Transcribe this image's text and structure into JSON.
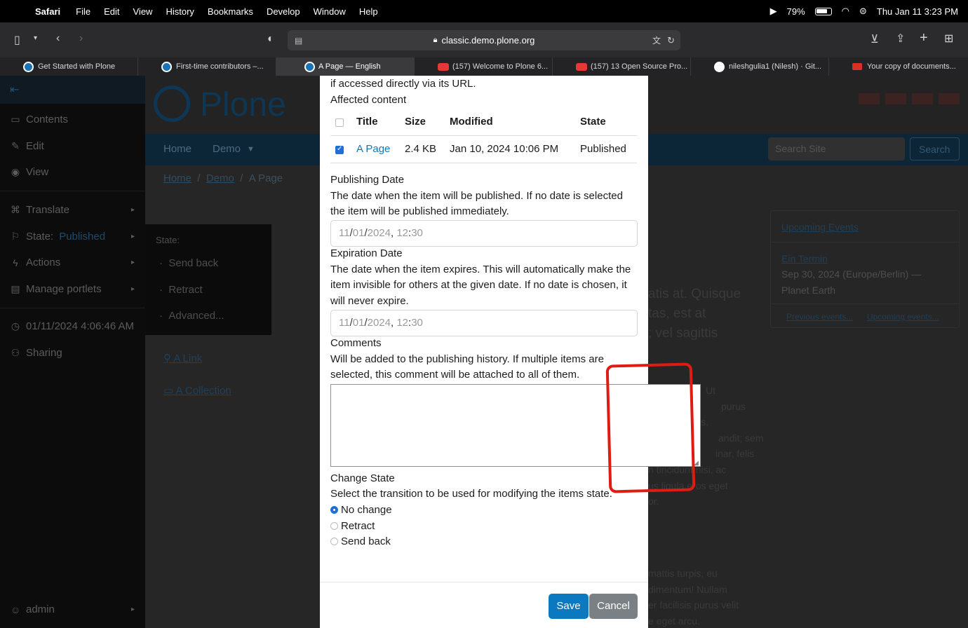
{
  "menubar": {
    "app": "Safari",
    "items": [
      "File",
      "Edit",
      "View",
      "History",
      "Bookmarks",
      "Develop",
      "Window",
      "Help"
    ],
    "battery": "79%",
    "datetime": "Thu Jan 11  3:23 PM"
  },
  "browser": {
    "url": "classic.demo.plone.org",
    "tabs": [
      {
        "title": "Get Started with Plone"
      },
      {
        "title": "First-time contributors –..."
      },
      {
        "title": "A Page — English"
      },
      {
        "title": "(157) Welcome to Plone 6..."
      },
      {
        "title": "(157) 13 Open Source Pro..."
      },
      {
        "title": "nileshgulia1 (Nilesh) · Git..."
      },
      {
        "title": "Your copy of documents..."
      }
    ]
  },
  "sidebar": {
    "items": [
      "Contents",
      "Edit",
      "View",
      "Translate",
      "State:",
      "Actions",
      "Manage portlets"
    ],
    "state_value": "Published",
    "date": "01/11/2024 4:06:46 AM",
    "sharing": "Sharing",
    "user": "admin"
  },
  "site": {
    "logo": "Plone",
    "nav": [
      "Home",
      "Demo"
    ],
    "search_placeholder": "Search Site",
    "search_button": "Search",
    "breadcrumb": [
      "Home",
      "Demo",
      "A Page"
    ],
    "state_menu": {
      "label": "State:",
      "items": [
        "Send back",
        "Retract",
        "Advanced..."
      ]
    },
    "links": [
      "A Link",
      "A Collection"
    ],
    "portlet": {
      "title": "Upcoming Events",
      "event_title": "Ein Termin",
      "event_date": "Sep 30, 2024 (Europe/Berlin) —",
      "event_location": "Planet Earth",
      "prev": "Previous events...",
      "next": "Upcoming events..."
    },
    "bg_text": [
      "atis at. Quisque",
      "tas, est at",
      "; vel sagittis",
      "Ut",
      "purus",
      "is.",
      "andit; sem",
      "inar, felis",
      "n tincidunt nisi, ac",
      "us ligula eros eget",
      "or.",
      "mattis turpis, eu",
      "dimentum! Nullam",
      "er facilisis purus velit",
      "e eget arcu."
    ]
  },
  "modal": {
    "intro": "if accessed directly via its URL.",
    "affected_title": "Affected content",
    "table": {
      "headers": [
        "Title",
        "Size",
        "Modified",
        "State"
      ],
      "rows": [
        {
          "title": "A Page",
          "size": "2.4 KB",
          "modified": "Jan 10, 2024 10:06 PM",
          "state": "Published",
          "checked": true
        }
      ]
    },
    "publishing_date": {
      "label": "Publishing Date",
      "help1": "The date when the item will be published. If no date is selected",
      "help2": "the item will be published immediately.",
      "day": "11",
      "month": "01",
      "year": "2024",
      "hour": "12",
      "minute": "30"
    },
    "expiration_date": {
      "label": "Expiration Date",
      "help1": "The date when the item expires. This will automatically make the",
      "help2": "item invisible for others at the given date. If no date is chosen, it",
      "help3": "will never expire.",
      "day": "11",
      "month": "01",
      "year": "2024",
      "hour": "12",
      "minute": "30"
    },
    "comments": {
      "label": "Comments",
      "help1": "Will be added to the publishing history. If multiple items are",
      "help2": "selected, this comment will be attached to all of them.",
      "value": ""
    },
    "change_state": {
      "label": "Change State",
      "help": "Select the transition to be used for modifying the items state.",
      "options": [
        "No change",
        "Retract",
        "Send back"
      ],
      "selected": "No change"
    },
    "save": "Save",
    "cancel": "Cancel"
  },
  "colors": {
    "accent": "#0a79c0",
    "annotation": "#e01b12"
  }
}
